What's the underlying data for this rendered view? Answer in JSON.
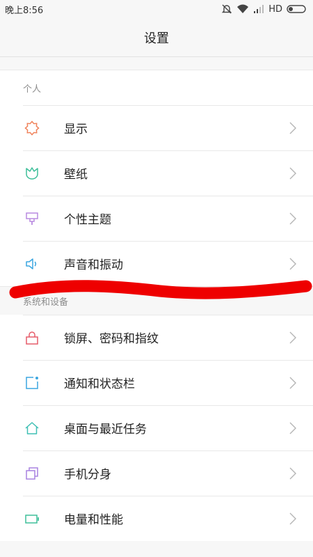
{
  "status": {
    "time": "晚上8:56",
    "network": "HD"
  },
  "header": {
    "title": "设置"
  },
  "section_personal": {
    "title": "个人",
    "items": [
      {
        "label": "显示",
        "icon": "brightness-icon",
        "color": "#f0825a"
      },
      {
        "label": "壁纸",
        "icon": "wallpaper-icon",
        "color": "#3fbf9a"
      },
      {
        "label": "个性主题",
        "icon": "theme-icon",
        "color": "#b98ae0"
      },
      {
        "label": "声音和振动",
        "icon": "speaker-icon",
        "color": "#3ba6e0"
      }
    ]
  },
  "section_system": {
    "title": "系统和设备",
    "items": [
      {
        "label": "锁屏、密码和指纹",
        "icon": "lock-icon",
        "color": "#e65c6a"
      },
      {
        "label": "通知和状态栏",
        "icon": "notification-icon",
        "color": "#3ba6e0"
      },
      {
        "label": "桌面与最近任务",
        "icon": "home-icon",
        "color": "#3fbfb4"
      },
      {
        "label": "手机分身",
        "icon": "dual-app-icon",
        "color": "#a882e0"
      },
      {
        "label": "电量和性能",
        "icon": "battery-icon",
        "color": "#3fbf9a"
      }
    ]
  },
  "annotation": {
    "color": "#ee0000"
  }
}
